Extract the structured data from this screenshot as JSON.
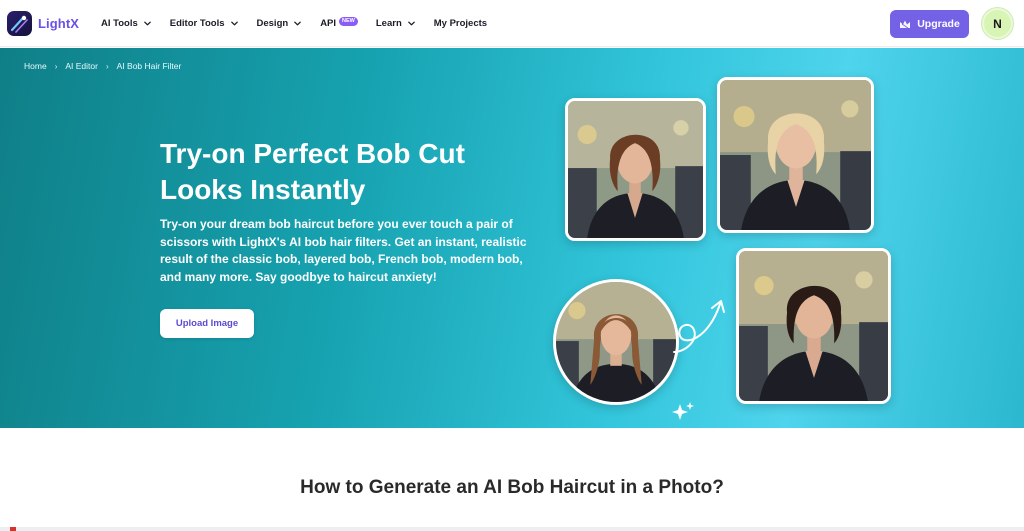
{
  "brand": {
    "name": "LightX",
    "icon": "lightx-logo-icon"
  },
  "nav": {
    "items": [
      {
        "label": "AI Tools",
        "has_dropdown": true
      },
      {
        "label": "Editor Tools",
        "has_dropdown": true
      },
      {
        "label": "Design",
        "has_dropdown": true
      },
      {
        "label": "API",
        "badge": "NEW",
        "has_dropdown": false
      },
      {
        "label": "Learn",
        "has_dropdown": true
      },
      {
        "label": "My Projects",
        "has_dropdown": false
      }
    ]
  },
  "header": {
    "upgrade_label": "Upgrade",
    "upgrade_icon": "crown-icon",
    "avatar_initial": "N"
  },
  "breadcrumb": [
    "Home",
    "AI Editor",
    "AI Bob Hair Filter"
  ],
  "hero": {
    "title": "Try-on Perfect Bob Cut Looks Instantly",
    "description": "Try-on your dream bob haircut before you ever touch a pair of scissors with LightX's AI bob hair filters. Get an instant, realistic result of the classic bob, layered bob, French bob, modern bob, and many more. Say goodbye to haircut anxiety!",
    "upload_label": "Upload Image"
  },
  "section": {
    "title": "How to Generate an AI Bob Haircut in a Photo?"
  },
  "colors": {
    "accent": "#7462e6",
    "brand_text": "#6a50e8",
    "hero_start": "#0f7f87",
    "hero_end": "#4ed4ec",
    "badge": "#8b5cf6"
  }
}
